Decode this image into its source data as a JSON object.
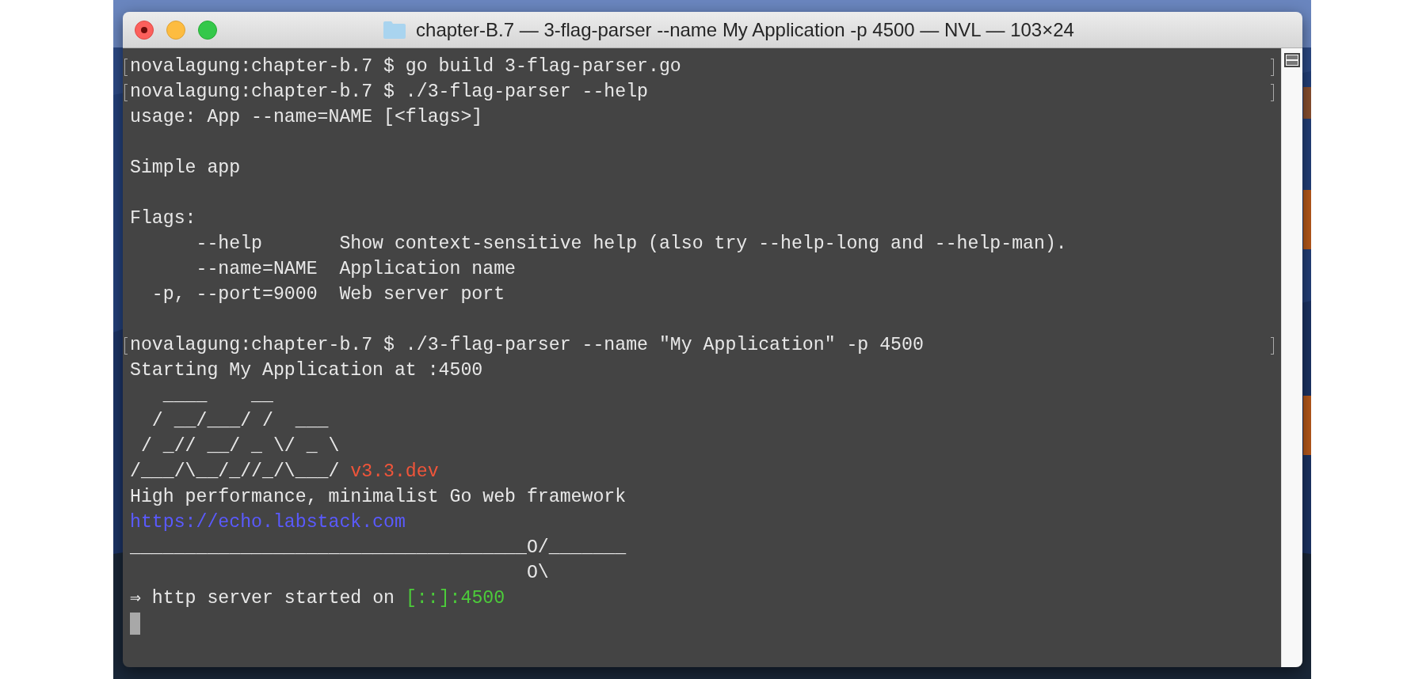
{
  "window": {
    "title": "chapter-B.7 — 3-flag-parser --name My Application -p 4500 — NVL — 103×24"
  },
  "terminal": {
    "cursor": true,
    "lines": [
      {
        "kind": "prompt",
        "marked": true,
        "text": "novalagung:chapter-b.7 $ go build 3-flag-parser.go"
      },
      {
        "kind": "prompt",
        "marked": true,
        "text": "novalagung:chapter-b.7 $ ./3-flag-parser --help"
      },
      {
        "kind": "output",
        "text": "usage: App --name=NAME [<flags>]"
      },
      {
        "kind": "blank"
      },
      {
        "kind": "output",
        "text": "Simple app"
      },
      {
        "kind": "blank"
      },
      {
        "kind": "output",
        "text": "Flags:"
      },
      {
        "kind": "output",
        "text": "      --help       Show context-sensitive help (also try --help-long and --help-man)."
      },
      {
        "kind": "output",
        "text": "      --name=NAME  Application name"
      },
      {
        "kind": "output",
        "text": "  -p, --port=9000  Web server port"
      },
      {
        "kind": "blank"
      },
      {
        "kind": "prompt",
        "marked": true,
        "text": "novalagung:chapter-b.7 $ ./3-flag-parser --name \"My Application\" -p 4500"
      },
      {
        "kind": "output",
        "text": "Starting My Application at :4500"
      },
      {
        "kind": "output",
        "text": "   ____    __"
      },
      {
        "kind": "output",
        "text": "  / __/___/ /  ___"
      },
      {
        "kind": "output",
        "text": " / _// __/ _ \\/ _ \\"
      },
      {
        "kind": "output",
        "segments": [
          {
            "text": "/___/\\__/_//_/\\___/ "
          },
          {
            "text": "v3.3.dev",
            "color": "#f0553a"
          }
        ]
      },
      {
        "kind": "output",
        "text": "High performance, minimalist Go web framework"
      },
      {
        "kind": "output",
        "segments": [
          {
            "text": "https://echo.labstack.com",
            "color": "#5a5aff"
          }
        ]
      },
      {
        "kind": "output",
        "text": "____________________________________O/_______"
      },
      {
        "kind": "output",
        "text": "                                    O\\"
      },
      {
        "kind": "output",
        "segments": [
          {
            "text": "⇒ http server started on "
          },
          {
            "text": "[::]:4500",
            "color": "#4ccc3a"
          }
        ]
      }
    ]
  }
}
